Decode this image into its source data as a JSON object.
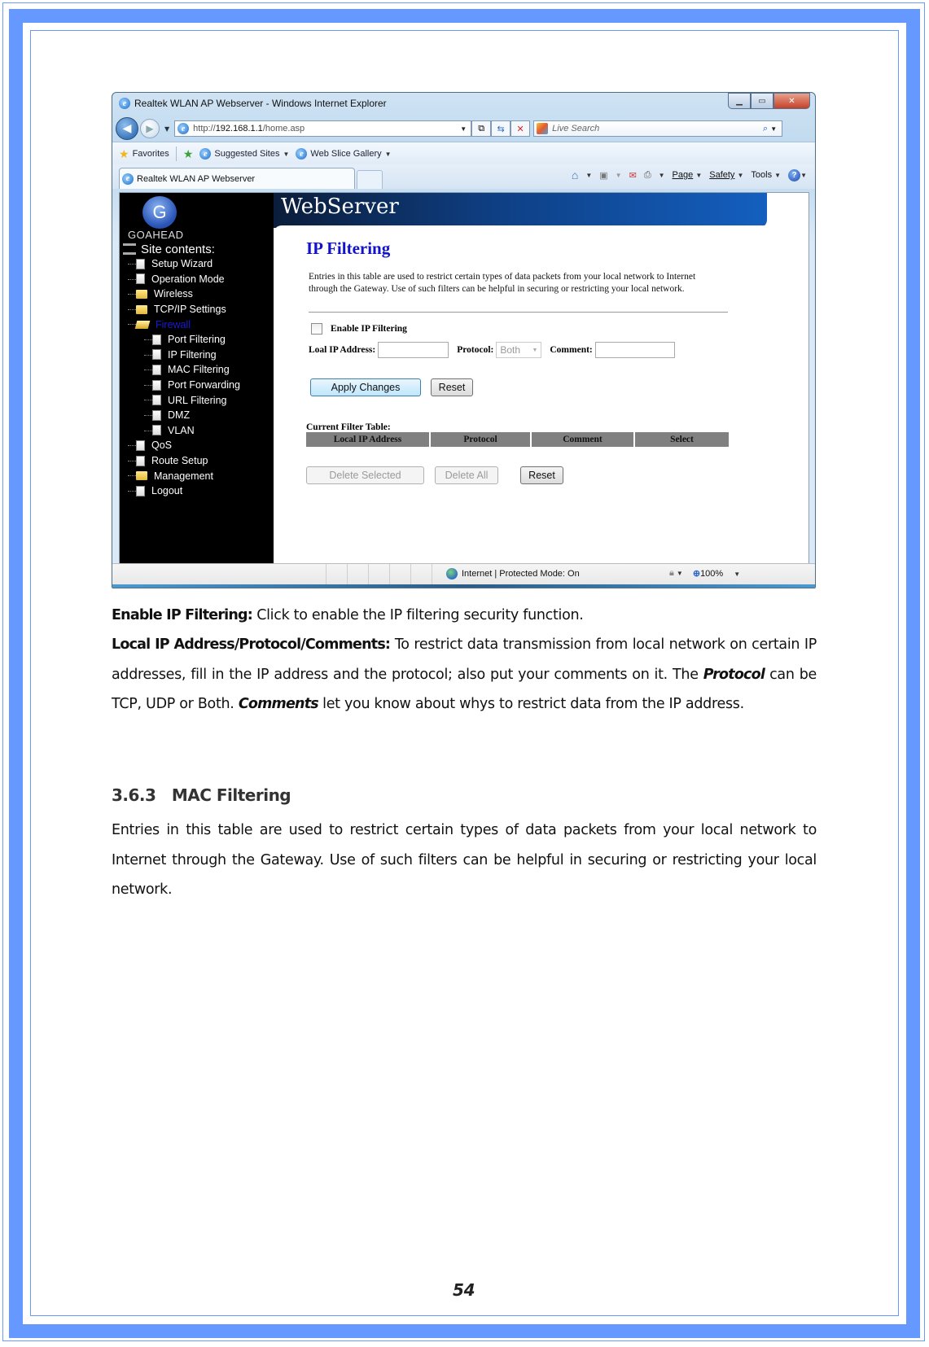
{
  "browser": {
    "window_title": "Realtek WLAN AP Webserver - Windows Internet Explorer",
    "address_prefix": "http://",
    "address_host": "192.168.1.1",
    "address_path": "/home.asp",
    "search_placeholder": "Live Search",
    "favorites_label": "Favorites",
    "suggested_sites_label": "Suggested Sites",
    "web_slice_label": "Web Slice Gallery",
    "tab_title": "Realtek WLAN AP Webserver",
    "command_bar": {
      "page": "Page",
      "safety": "Safety",
      "tools": "Tools"
    },
    "status_text": "Internet | Protected Mode: On",
    "zoom_level": "100%"
  },
  "webpage": {
    "logo_text": "GoAhead",
    "banner_title": "WebServer",
    "sidebar": {
      "root_label": "Site contents:",
      "items": [
        {
          "label": "Setup Wizard",
          "icon": "doc",
          "level": 1
        },
        {
          "label": "Operation Mode",
          "icon": "doc",
          "level": 1
        },
        {
          "label": "Wireless",
          "icon": "folder",
          "level": 1
        },
        {
          "label": "TCP/IP Settings",
          "icon": "folder",
          "level": 1
        },
        {
          "label": "Firewall",
          "icon": "folder-open",
          "level": 1,
          "active": true
        },
        {
          "label": "Port Filtering",
          "icon": "doc",
          "level": 2
        },
        {
          "label": "IP Filtering",
          "icon": "doc",
          "level": 2
        },
        {
          "label": "MAC Filtering",
          "icon": "doc",
          "level": 2
        },
        {
          "label": "Port Forwarding",
          "icon": "doc",
          "level": 2
        },
        {
          "label": "URL Filtering",
          "icon": "doc",
          "level": 2
        },
        {
          "label": "DMZ",
          "icon": "doc",
          "level": 2
        },
        {
          "label": "VLAN",
          "icon": "doc",
          "level": 2
        },
        {
          "label": "QoS",
          "icon": "doc",
          "level": 1
        },
        {
          "label": "Route Setup",
          "icon": "doc",
          "level": 1
        },
        {
          "label": "Management",
          "icon": "folder",
          "level": 1
        },
        {
          "label": "Logout",
          "icon": "doc",
          "level": 1
        }
      ]
    },
    "title": "IP Filtering",
    "description": "Entries in this table are used to restrict certain types of data packets from your local network to Internet through the Gateway. Use of such filters can be helpful in securing or restricting your local network.",
    "enable_label": "Enable IP Filtering",
    "enable_checked": false,
    "local_ip_label": "Loal IP Address:",
    "local_ip_value": "",
    "protocol_label": "Protocol:",
    "protocol_value": "Both",
    "comment_label": "Comment:",
    "comment_value": "",
    "apply_button": "Apply Changes",
    "reset_button": "Reset",
    "table_caption": "Current Filter Table:",
    "table_headers": [
      "Local IP Address",
      "Protocol",
      "Comment",
      "Select"
    ],
    "table_rows": [],
    "delete_selected_button": "Delete Selected",
    "delete_all_button": "Delete All",
    "table_reset_button": "Reset"
  },
  "document": {
    "p1_bold": "Enable IP Filtering:",
    "p1_text": " Click to enable the IP filtering security function.",
    "p2_bold": "Local IP Address/Protocol/Comments:",
    "p2_text_a": " To restrict data transmission from local network on certain IP addresses, fill in the IP address and the protocol; also put your comments on it. The ",
    "p2_bold_italic_1": "Protocol",
    "p2_text_b": " can be TCP, UDP or Both. ",
    "p2_bold_italic_2": "Comments",
    "p2_text_c": " let you know about whys to restrict data from the IP address.",
    "section_heading": "3.6.3   MAC Filtering",
    "section_text": "Entries in this table are used to restrict certain types of data packets from your local network to Internet through the Gateway. Use of such filters can be helpful in securing or restricting your local network.",
    "page_number": "54"
  },
  "colors": {
    "frame_blue": "#6699ff",
    "title_blue": "#1212c8",
    "table_header_gray": "#808080"
  }
}
